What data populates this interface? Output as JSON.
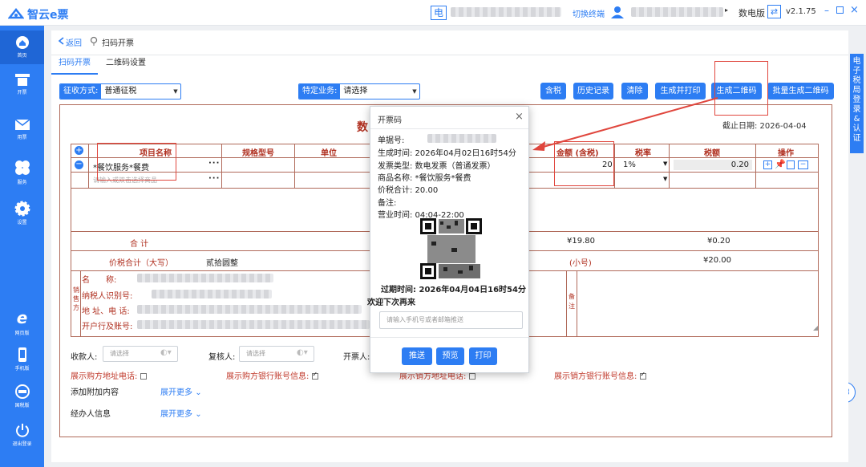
{
  "app": {
    "title": "智云e票",
    "version": "v2.1.75",
    "edition": "数电版",
    "switch_terminal": "切换终端",
    "tax_label": "电"
  },
  "sidebar": [
    {
      "label": "首页",
      "icon": "home-icon"
    },
    {
      "label": "开票",
      "icon": "invoice-icon"
    },
    {
      "label": "用票",
      "icon": "mail-icon"
    },
    {
      "label": "服务",
      "icon": "service-icon"
    },
    {
      "label": "设置",
      "icon": "settings-icon"
    },
    {
      "label": "网页版",
      "icon": "ie-icon"
    },
    {
      "label": "手机版",
      "icon": "mobile-icon"
    },
    {
      "label": "国税版",
      "icon": "tax-icon"
    },
    {
      "label": "退出登录",
      "icon": "power-icon"
    }
  ],
  "header": {
    "back": "返回",
    "page_title": "扫码开票"
  },
  "tabs": [
    {
      "label": "扫码开票",
      "active": true
    },
    {
      "label": "二维码设置",
      "active": false
    }
  ],
  "filters": {
    "levy_label": "征收方式:",
    "levy_value": "普通征税",
    "special_label": "特定业务:",
    "special_value": "请选择"
  },
  "toolbar": {
    "tax_incl": "含税",
    "history": "历史记录",
    "clear": "清除",
    "gen_print": "生成并打印",
    "gen_qr": "生成二维码",
    "batch_qr": "批量生成二维码"
  },
  "invoice": {
    "title_visible": "数",
    "deadline": "截止日期: 2026-04-04",
    "headers": {
      "name": "项目名称",
      "spec": "规格型号",
      "unit": "单位",
      "amount": "金额 (含税)",
      "rate": "税率",
      "tax": "税额",
      "ops": "操作"
    },
    "row1": {
      "name": "*餐饮服务*餐费",
      "amount": "20",
      "rate": "1%",
      "tax": "0.20"
    },
    "row2": {
      "placeholder": "请输入或双击选择商品"
    },
    "total_label": "合 计",
    "total_amount": "¥19.80",
    "total_tax": "¥0.20",
    "sum_label": "价税合计（大写）",
    "sum_words": "贰拾圆整",
    "small_label": "(小号)",
    "small_value": "¥20.00",
    "seller_title": "销售方",
    "seller_fields": [
      "名　　称:",
      "纳税人识别号:",
      "地 址、电 话:",
      "开户行及账号:"
    ],
    "remark": "备注"
  },
  "bottom": {
    "payee": "收款人:",
    "reviewer": "复核人:",
    "drawer": "开票人:",
    "select_ph": "请选择",
    "show_buyer_addr": "展示购方地址电话:",
    "show_buyer_bank": "展示购方银行账号信息:",
    "show_seller_addr": "展示销方地址电话:",
    "show_seller_bank": "展示销方银行账号信息:",
    "add_extra": "添加附加内容",
    "expand": "展开更多",
    "agent": "经办人信息"
  },
  "modal": {
    "title": "开票码",
    "bill_no_label": "单据号:",
    "gen_time": "生成时间:  2026年04月02日16时54分",
    "type": "发票类型:  数电发票（普通发票）",
    "goods": "商品名称:  *餐饮服务*餐费",
    "total": "价税合计:  20.00",
    "remark": "备注:",
    "hours": "营业时间:  04:04-22:00",
    "expire": "过期时间: 2026年04月04日16时54分",
    "welcome": "欢迎下次再来",
    "input_ph": "请输入手机号或者邮箱推送",
    "push": "推送",
    "preview": "预览",
    "print": "打印"
  },
  "right_panel": "电子税局登录&认证",
  "colors": {
    "brand": "#2d7df3",
    "annotation": "#e0463d",
    "invoice_border": "#b06a5a"
  }
}
